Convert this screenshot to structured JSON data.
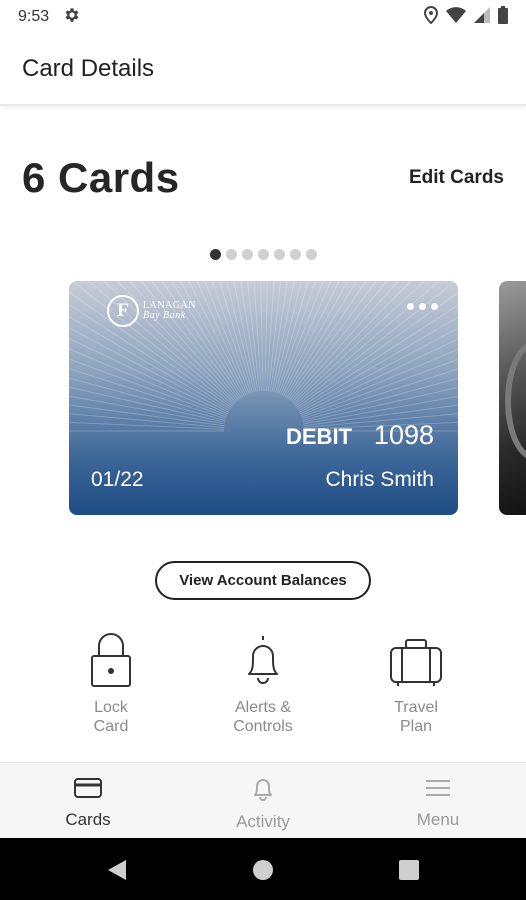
{
  "status_bar": {
    "time": "9:53",
    "icons": [
      "settings-gear-icon",
      "location-pin-icon",
      "wifi-icon",
      "cell-signal-icon",
      "battery-icon"
    ]
  },
  "app_bar": {
    "title": "Card Details"
  },
  "cards_header": {
    "count_label": "6 Cards",
    "edit_label": "Edit Cards"
  },
  "pager": {
    "total": 7,
    "active_index": 0
  },
  "card": {
    "brand_initial": "F",
    "brand_line1": "LANAGAN",
    "brand_line2": "Bay Bank",
    "type": "DEBIT",
    "last4": "1098",
    "expiry": "01/22",
    "holder": "Chris Smith",
    "gradient_top": "#c6ccd6",
    "gradient_bottom": "#1f4c85"
  },
  "balances_button": {
    "label": "View Account Balances"
  },
  "actions": [
    {
      "line1": "Lock",
      "line2": "Card",
      "icon": "lock-icon"
    },
    {
      "line1": "Alerts &",
      "line2": "Controls",
      "icon": "bell-icon"
    },
    {
      "line1": "Travel",
      "line2": "Plan",
      "icon": "suitcase-icon"
    }
  ],
  "bottom_nav": [
    {
      "label": "Cards",
      "icon": "credit-card-icon",
      "active": true
    },
    {
      "label": "Activity",
      "icon": "bell-icon",
      "active": false
    },
    {
      "label": "Menu",
      "icon": "hamburger-menu-icon",
      "active": false
    }
  ],
  "colors": {
    "accent_dark": "#222222",
    "muted": "#8a8a8a",
    "nav_bg": "#f6f6f6"
  }
}
